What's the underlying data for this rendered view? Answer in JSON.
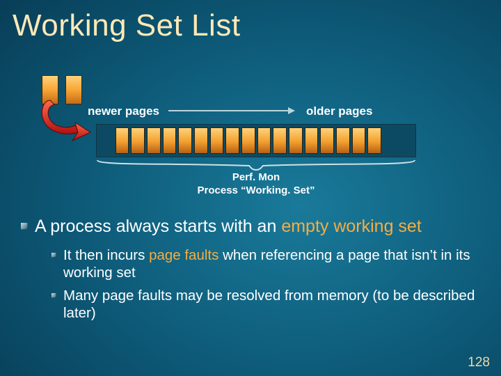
{
  "title": "Working Set List",
  "labels": {
    "newer": "newer pages",
    "older": "older pages"
  },
  "perfmon": {
    "line1": "Perf. Mon",
    "line2": "Process “Working. Set”"
  },
  "array": {
    "total_slots": 20,
    "filled_slots": 17
  },
  "bullets": {
    "first_pre": "A process always starts with an ",
    "first_hl": "empty working set",
    "sub1_pre": "It then incurs ",
    "sub1_hl": "page faults",
    "sub1_post": " when referencing a page that isn’t in its working set",
    "sub2": "Many page faults may be resolved from memory (to be described later)"
  },
  "page_number": "128"
}
